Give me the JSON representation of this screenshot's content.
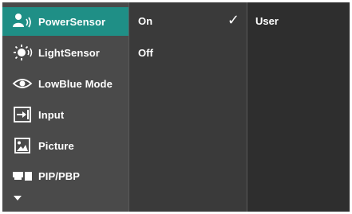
{
  "menu": {
    "items": [
      {
        "label": "PowerSensor",
        "icon": "power-sensor-icon",
        "active": true
      },
      {
        "label": "LightSensor",
        "icon": "light-sensor-icon",
        "active": false
      },
      {
        "label": "LowBlue Mode",
        "icon": "eye-icon",
        "active": false
      },
      {
        "label": "Input",
        "icon": "input-arrow-icon",
        "active": false
      },
      {
        "label": "Picture",
        "icon": "picture-icon",
        "active": false
      },
      {
        "label": "PIP/PBP",
        "icon": "pip-pbp-icon",
        "active": false
      }
    ],
    "more_icon": "chevron-down-icon"
  },
  "submenu": {
    "items": [
      {
        "label": "On",
        "selected": true,
        "check": "✓"
      },
      {
        "label": "Off",
        "selected": false
      }
    ]
  },
  "values": {
    "items": [
      {
        "label": "User"
      }
    ]
  },
  "colors": {
    "accent": "#1f8f86",
    "menu_bg": "#4a4a4a",
    "submenu_bg": "#3a3a3a",
    "value_bg": "#2e2e2e",
    "text": "#ffffff"
  }
}
